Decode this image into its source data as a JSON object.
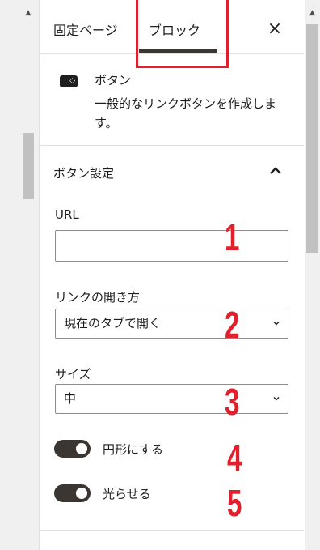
{
  "tabs": {
    "page": "固定ページ",
    "block": "ブロック",
    "close_symbol": "×"
  },
  "block": {
    "title": "ボタン",
    "description": "一般的なリンクボタンを作成します。",
    "icon": "button-block-icon"
  },
  "settings": {
    "section_title": "ボタン設定",
    "url_label": "URL",
    "url_value": "",
    "link_open_label": "リンクの開き方",
    "link_open_value": "現在のタブで開く",
    "size_label": "サイズ",
    "size_value": "中",
    "round_label": "円形にする",
    "round_on": true,
    "shine_label": "光らせる",
    "shine_on": true
  },
  "annotations": [
    "1",
    "2",
    "3",
    "4",
    "5"
  ],
  "colors": {
    "annotation": "#e0202c",
    "toggle_on": "#3b3631",
    "accent_dark": "#1e1e1e"
  }
}
